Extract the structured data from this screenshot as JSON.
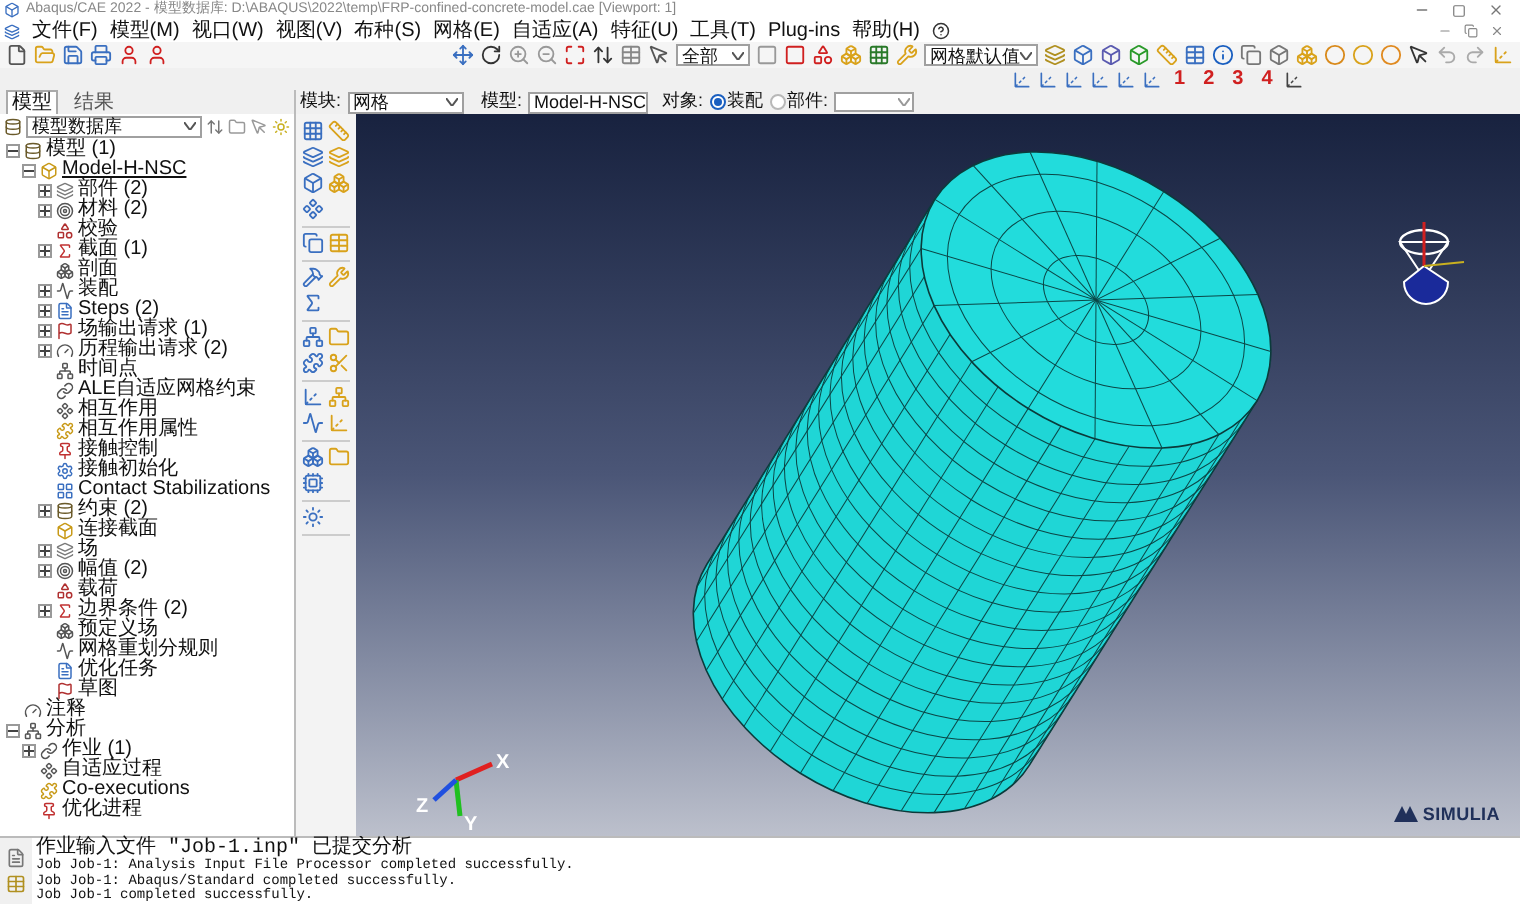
{
  "window": {
    "title": "Abaqus/CAE 2022 - 模型数据库: D:\\ABAQUS\\2022\\temp\\FRP-confined-concrete-model.cae [Viewport: 1]"
  },
  "menu": [
    "文件(F)",
    "模型(M)",
    "视口(W)",
    "视图(V)",
    "布种(S)",
    "网格(E)",
    "自适应(A)",
    "特征(U)",
    "工具(T)",
    "Plug-ins",
    "帮助(H)"
  ],
  "toolbar": {
    "select_filter": "全部",
    "mesh_defaults": "网格默认值",
    "views": [
      "1",
      "2",
      "3",
      "4"
    ]
  },
  "context": {
    "module_label": "模块:",
    "module": "网格",
    "model_label": "模型:",
    "model": "Model-H-NSC",
    "object_label": "对象:",
    "objects": [
      {
        "label": "装配",
        "selected": true
      },
      {
        "label": "部件:",
        "selected": false
      }
    ]
  },
  "tabs": [
    {
      "label": "模型",
      "selected": true
    },
    {
      "label": "结果",
      "selected": false
    }
  ],
  "tree_filter": "模型数据库",
  "tree": [
    {
      "label": "模型 (1)",
      "expanded": true,
      "children": [
        {
          "label": "Model-H-NSC",
          "expanded": true,
          "current": true,
          "children": [
            {
              "label": "部件 (2)",
              "expanded": false
            },
            {
              "label": "材料 (2)",
              "expanded": false
            },
            {
              "label": "校验"
            },
            {
              "label": "截面 (1)",
              "expanded": false
            },
            {
              "label": "剖面"
            },
            {
              "label": "装配",
              "expanded": false
            },
            {
              "label": "Steps (2)",
              "expanded": false
            },
            {
              "label": "场输出请求 (1)",
              "expanded": false
            },
            {
              "label": "历程输出请求 (2)",
              "expanded": false
            },
            {
              "label": "时间点"
            },
            {
              "label": "ALE自适应网格约束"
            },
            {
              "label": "相互作用"
            },
            {
              "label": "相互作用属性"
            },
            {
              "label": "接触控制"
            },
            {
              "label": "接触初始化"
            },
            {
              "label": "Contact Stabilizations"
            },
            {
              "label": "约束 (2)",
              "expanded": false
            },
            {
              "label": "连接截面"
            },
            {
              "label": "场",
              "expanded": false
            },
            {
              "label": "幅值 (2)",
              "expanded": false
            },
            {
              "label": "载荷"
            },
            {
              "label": "边界条件 (2)",
              "expanded": false
            },
            {
              "label": "预定义场"
            },
            {
              "label": "网格重划分规则"
            },
            {
              "label": "优化任务"
            },
            {
              "label": "草图"
            }
          ]
        }
      ]
    },
    {
      "label": "注释"
    },
    {
      "label": "分析",
      "expanded": true,
      "children": [
        {
          "label": "作业 (1)",
          "expanded": false
        },
        {
          "label": "自适应过程"
        },
        {
          "label": "Co-executions"
        },
        {
          "label": "优化进程"
        }
      ]
    }
  ],
  "viewport": {
    "axes": [
      "X",
      "Y",
      "Z"
    ],
    "logo_text": "SIMULIA"
  },
  "messages": [
    "作业输入文件 \"Job-1.inp\" 已提交分析",
    "Job Job-1: Analysis Input File Processor completed successfully.",
    "Job Job-1: Abaqus/Standard completed successfully.",
    "Job Job-1 completed successfully."
  ]
}
